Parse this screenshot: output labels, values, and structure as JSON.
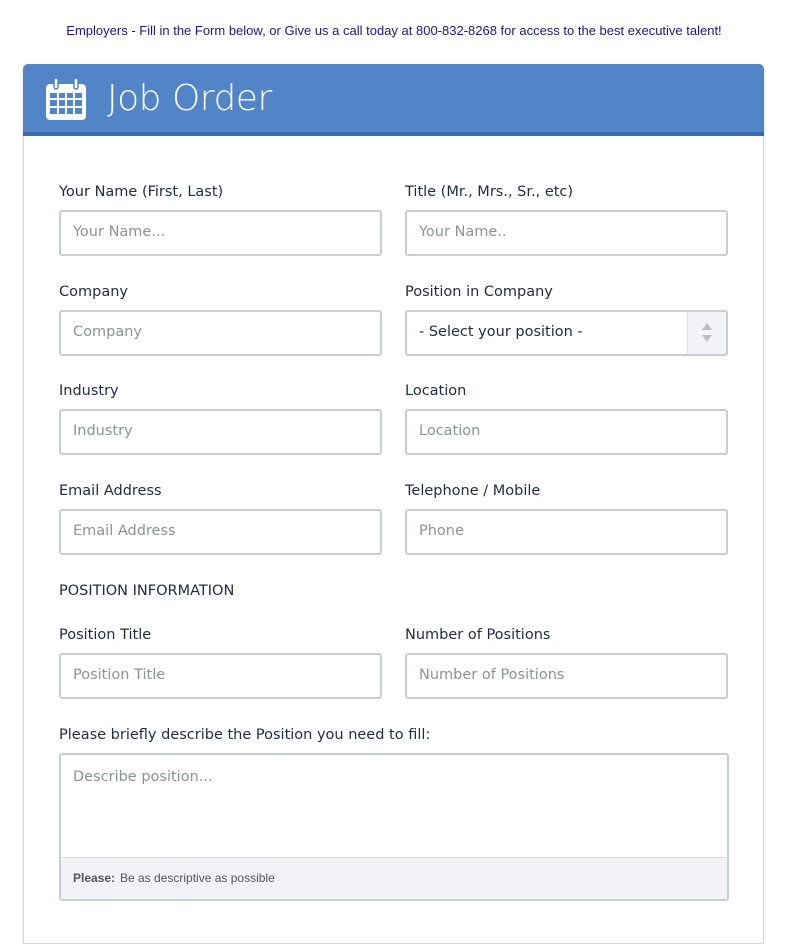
{
  "intro_text": "Employers - Fill in the Form below, or Give us a call today at 800-832-8268 for access to the best executive talent!",
  "header": {
    "icon": "calendar-icon",
    "title": "Job Order"
  },
  "fields": {
    "name": {
      "label": "Your Name (First, Last)",
      "placeholder": "Your Name..."
    },
    "title": {
      "label": "Title (Mr., Mrs., Sr., etc)",
      "placeholder": "Your Name.."
    },
    "company": {
      "label": "Company",
      "placeholder": "Company"
    },
    "position_in_company": {
      "label": "Position in Company",
      "selected": "- Select your position -"
    },
    "industry": {
      "label": "Industry",
      "placeholder": "Industry"
    },
    "location": {
      "label": "Location",
      "placeholder": "Location"
    },
    "email": {
      "label": "Email Address",
      "placeholder": "Email Address"
    },
    "phone": {
      "label": "Telephone / Mobile",
      "placeholder": "Phone"
    },
    "position_title": {
      "label": "Position Title",
      "placeholder": "Position Title"
    },
    "num_positions": {
      "label": "Number of Positions",
      "placeholder": "Number of Positions"
    },
    "description": {
      "label": "Please briefly describe the Position you need to fill:",
      "placeholder": "Describe position...",
      "note_bold": "Please:",
      "note_text": "Be as descriptive as possible"
    }
  },
  "section_position_info": "POSITION INFORMATION"
}
